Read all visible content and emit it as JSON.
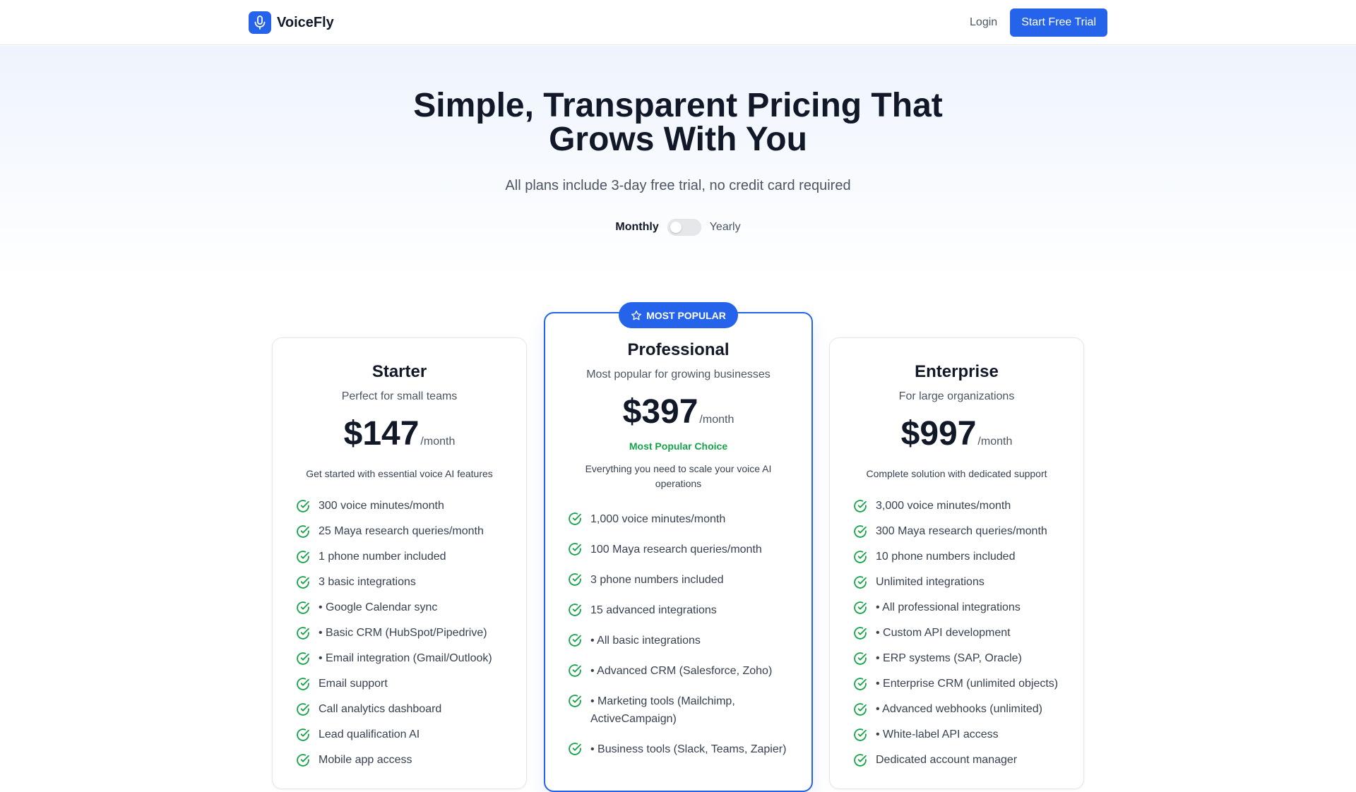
{
  "header": {
    "brand": "VoiceFly",
    "login_label": "Login",
    "cta_label": "Start Free Trial"
  },
  "hero": {
    "title_line1": "Simple, Transparent Pricing That",
    "title_line2": "Grows With You",
    "subtitle": "All plans include 3-day free trial, no credit card required"
  },
  "billing": {
    "monthly_label": "Monthly",
    "yearly_label": "Yearly",
    "selected": "Monthly"
  },
  "colors": {
    "accent": "#2563eb",
    "success": "#16a34a"
  },
  "plans": {
    "starter": {
      "name": "Starter",
      "description": "Perfect for small teams",
      "price": "$147",
      "period": "/month",
      "tagline": "Get started with essential voice AI features",
      "features": [
        "300 voice minutes/month",
        "25 Maya research queries/month",
        "1 phone number included",
        "3 basic integrations",
        "• Google Calendar sync",
        "• Basic CRM (HubSpot/Pipedrive)",
        "• Email integration (Gmail/Outlook)",
        "Email support",
        "Call analytics dashboard",
        "Lead qualification AI",
        "Mobile app access"
      ]
    },
    "professional": {
      "badge": "MOST POPULAR",
      "name": "Professional",
      "description": "Most popular for growing businesses",
      "price": "$397",
      "period": "/month",
      "highlight": "Most Popular Choice",
      "tagline": "Everything you need to scale your voice AI operations",
      "features": [
        "1,000 voice minutes/month",
        "100 Maya research queries/month",
        "3 phone numbers included",
        "15 advanced integrations",
        "• All basic integrations",
        "• Advanced CRM (Salesforce, Zoho)",
        "• Marketing tools (Mailchimp, ActiveCampaign)",
        "• Business tools (Slack, Teams, Zapier)"
      ]
    },
    "enterprise": {
      "name": "Enterprise",
      "description": "For large organizations",
      "price": "$997",
      "period": "/month",
      "tagline": "Complete solution with dedicated support",
      "features": [
        "3,000 voice minutes/month",
        "300 Maya research queries/month",
        "10 phone numbers included",
        "Unlimited integrations",
        "• All professional integrations",
        "• Custom API development",
        "• ERP systems (SAP, Oracle)",
        "• Enterprise CRM (unlimited objects)",
        "• Advanced webhooks (unlimited)",
        "• White-label API access",
        "Dedicated account manager"
      ]
    }
  }
}
